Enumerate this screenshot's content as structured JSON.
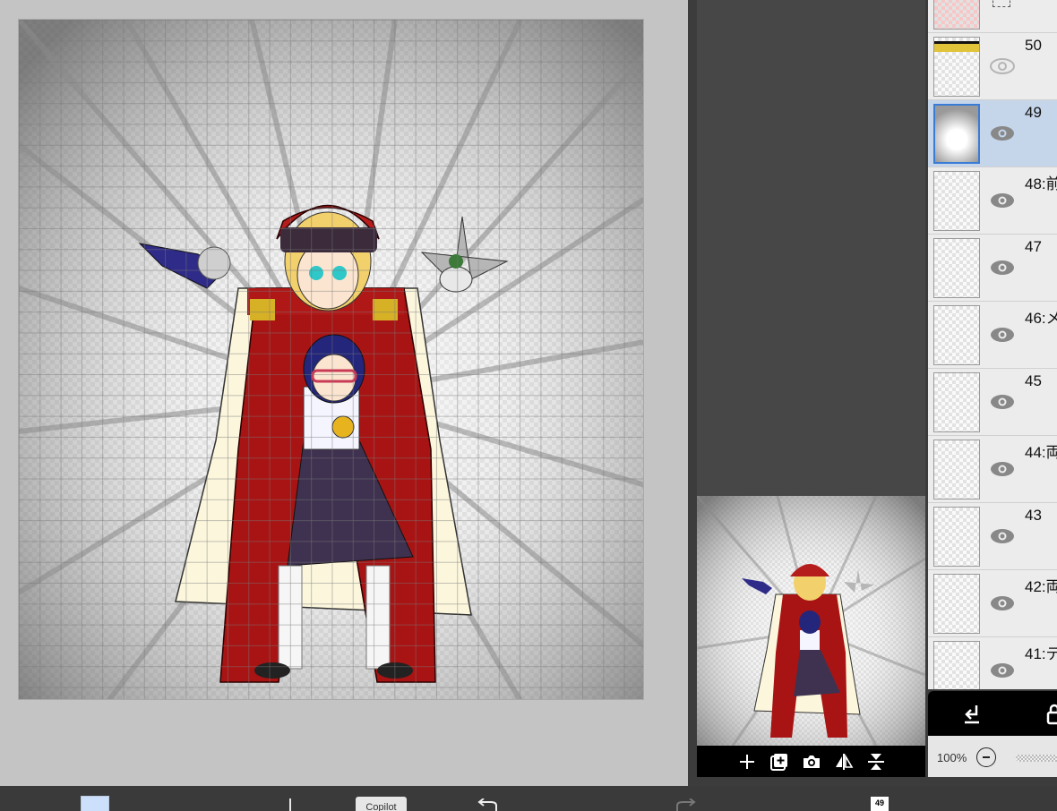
{
  "app": {
    "accent_color": "#3a7bd5",
    "selected_row_color": "#c5d5ea",
    "current_color": "#cde0fb"
  },
  "layers": [
    {
      "name": "50",
      "visible": false
    },
    {
      "name": "49",
      "visible": true,
      "selected": true
    },
    {
      "name": "48:前",
      "visible": true
    },
    {
      "name": "47",
      "visible": true
    },
    {
      "name": "46:メ",
      "visible": true
    },
    {
      "name": "45",
      "visible": true
    },
    {
      "name": "44:両",
      "visible": true
    },
    {
      "name": "43",
      "visible": true
    },
    {
      "name": "42:両",
      "visible": true
    },
    {
      "name": "41:デ",
      "visible": true
    }
  ],
  "layer_panel": {
    "opacity_label": "100%"
  },
  "navigator": {
    "tools": [
      "add-icon",
      "add-layer-icon",
      "camera-icon",
      "flip-horizontal-icon",
      "flip-vertical-icon"
    ]
  },
  "bottom_bar": {
    "copilot_label": "Copilot",
    "layer_count": "49"
  }
}
